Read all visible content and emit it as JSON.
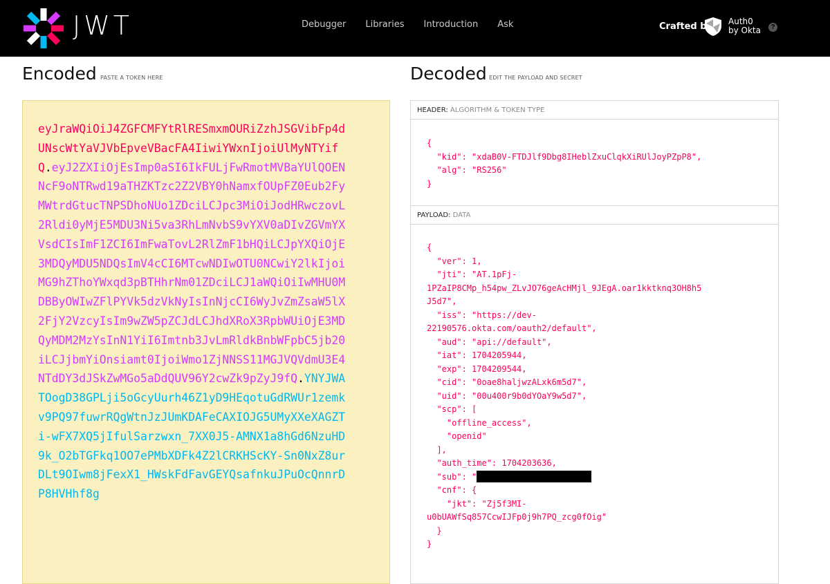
{
  "header": {
    "logo_text": "JWT",
    "nav": [
      "Debugger",
      "Libraries",
      "Introduction",
      "Ask"
    ],
    "crafted_by": "Crafted by",
    "brand_line1": "Auth0",
    "brand_line2": "by Okta",
    "help_glyph": "?"
  },
  "encoded": {
    "title": "Encoded",
    "subtitle": "PASTE A TOKEN HERE",
    "header_part": "eyJraWQiOiJ4ZGFCMFYtRlRESmxmOURiZzhJSGVibFp4dUNscWtYaVJVbEpveVBacFA4IiwiYWxnIjoiUlMyNTYifQ",
    "payload_part": "eyJ2ZXIiOjEsImp0aSI6IkFULjFwRmotMVBaYUlQOENNcF9oNTRwd19aTHZKTzc2Z2VBY0hNamxfOUpFZ0Eub2FyMWtrdGtucTNPSDhoNUo1ZDciLCJpc3MiOiJodHRwczovL2Rldi0yMjE5MDU3Ni5va3RhLmNvbS9vYXV0aDIvZGVmYXVsdCIsImF1ZCI6ImFwaTovL2RlZmF1bHQiLCJpYXQiOjE3MDQyMDU5NDQsImV4cCI6MTcwNDIwOTU0NCwiY2lkIjoiMG9hZThoYWxqd3pBTHhrNm01ZDciLCJ1aWQiOiIwMHU0MDBByOWIwZFlPYVk5dzVkNyIsInNjcCI6WyJvZmZsaW5lX2FjY2VzcyIsIm9wZW5pZCJdLCJhdXRoX3RpbWUiOjE3MDQyMDM2MzYsInN1YiI6Imtnb3JvLmRldkBnbWFpbC5jb20iLCJjbmYiOnsiamt0IjoiWmo1ZjNNSS11MGJVQVdmU3E4NTdDY3dJSkZwMGo5aDdQUV96Y2cwZk9pZyJ9fQ",
    "signature_part": "YNYJWATOogD38GPLji5oGcyUurh46Z1yD9HEqotuGdRWUr1zemkv9PQ97fuwrRQgWtnJzJUmKDAFeCAXIOJG5UMyXXeXAGZTi-wFX7XQ5jIfulSarzwxn_7XX0J5-AMNX1a8hGd6NzuHD9k_O2bTGFkq1OO7ePMbXDFk4Z2lCRKHScKY-Sn0NxZ8urDLt9OIwm8jFexX1_HWskFdFavGEYQsafnkuJPuOcQnnrDP8HVHhf8g",
    "dot": "."
  },
  "decoded": {
    "title": "Decoded",
    "subtitle": "EDIT THE PAYLOAD AND SECRET",
    "header_label": "HEADER:",
    "header_desc": "ALGORITHM & TOKEN TYPE",
    "header_json": "{\n  \"kid\": \"xdaB0V-FTDJlf9Dbg8IHeblZxuClqkXiRUlJoyPZpP8\",\n  \"alg\": \"RS256\"\n}",
    "payload_label": "PAYLOAD:",
    "payload_desc": "DATA",
    "payload_json_top": "{\n  \"ver\": 1,\n  \"jti\": \"AT.1pFj-\n1PZaIP8CMp_h54pw_ZLvJO76geAcHMjl_9JEgA.oar1kktknq3OH8h5\nJ5d7\",\n  \"iss\": \"https://dev-\n22190576.okta.com/oauth2/default\",\n  \"aud\": \"api://default\",\n  \"iat\": 1704205944,\n  \"exp\": 1704209544,\n  \"cid\": \"0oae8haljwzALxk6m5d7\",\n  \"uid\": \"00u400r9b0dYOaY9w5d7\",\n  \"scp\": [\n    \"offline_access\",\n    \"openid\"\n  ],\n  \"auth_time\": 1704203636,",
    "sub_prefix": "  \"sub\": \"",
    "payload_json_bottom": "  \"cnf\": {\n    \"jkt\": \"Zj5f3MI-\nu0bUAWfSq857CcwIJFp0j9h7PQ_zcg0fOig\"\n  }\n}"
  }
}
